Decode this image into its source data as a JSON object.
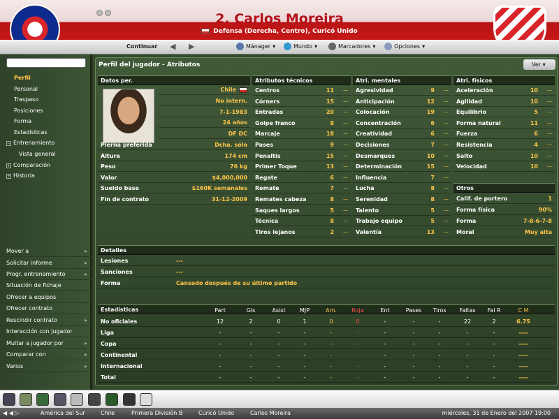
{
  "header": {
    "title": "2. Carlos Moreira",
    "subtitle": "Defensa (Derecha, Centro), Curicó Unido",
    "continuar": "Continuar",
    "menus": [
      "Mánager",
      "Mundo",
      "Marcadores",
      "Opciones"
    ]
  },
  "sidebar": {
    "items": [
      "Perfil",
      "Personal",
      "Traspaso",
      "Posiciones",
      "Forma",
      "Estadísticas",
      "Entrenamiento",
      "Vista general",
      "Comparación",
      "Historia"
    ],
    "actions": [
      "Mover a",
      "Solicitar informe",
      "Progr. entrenamiento",
      "Situación de fichaje",
      "Ofrecer a equipos",
      "Ofrecer contrato",
      "Rescindir contrato",
      "Interacción con jugador",
      "Multar a jugador por",
      "Comparar con",
      "Varios"
    ]
  },
  "panel": {
    "title": "Perfil del jugador - Atributos",
    "ver": "Ver"
  },
  "personal": {
    "heading": "Datos per.",
    "nationality": "Chile",
    "intl": "No intern.",
    "dob": "7-1-1983",
    "age": "24 años",
    "pos": "DF DC",
    "rows": [
      {
        "k": "Pierna preferida",
        "v": "Dcha. sólo"
      },
      {
        "k": "Altura",
        "v": "174 cm"
      },
      {
        "k": "Peso",
        "v": "76 kg"
      },
      {
        "k": "Valor",
        "v": "$4,000,000"
      },
      {
        "k": "Sueldo base",
        "v": "$160K semanales"
      },
      {
        "k": "Fin de contrato",
        "v": "31-12-2009"
      }
    ]
  },
  "technical": {
    "heading": "Atributos técnicos",
    "rows": [
      {
        "k": "Centros",
        "v": "11"
      },
      {
        "k": "Córners",
        "v": "15"
      },
      {
        "k": "Entradas",
        "v": "20"
      },
      {
        "k": "Golpe franco",
        "v": "8"
      },
      {
        "k": "Marcaje",
        "v": "18"
      },
      {
        "k": "Pases",
        "v": "9"
      },
      {
        "k": "Penaltis",
        "v": "15"
      },
      {
        "k": "Primer Toque",
        "v": "13"
      },
      {
        "k": "Regate",
        "v": "6"
      },
      {
        "k": "Remate",
        "v": "7"
      },
      {
        "k": "Remates cabeza",
        "v": "8"
      },
      {
        "k": "Saques largos",
        "v": "5"
      },
      {
        "k": "Técnica",
        "v": "8"
      },
      {
        "k": "Tiros lejanos",
        "v": "2"
      }
    ]
  },
  "mental": {
    "heading": "Atri. mentales",
    "rows": [
      {
        "k": "Agresividad",
        "v": "9"
      },
      {
        "k": "Anticipación",
        "v": "12"
      },
      {
        "k": "Colocación",
        "v": "19"
      },
      {
        "k": "Concentración",
        "v": "6"
      },
      {
        "k": "Creatividad",
        "v": "6"
      },
      {
        "k": "Decisiones",
        "v": "7"
      },
      {
        "k": "Desmarques",
        "v": "10"
      },
      {
        "k": "Determinación",
        "v": "15"
      },
      {
        "k": "Influencia",
        "v": "7"
      },
      {
        "k": "Lucha",
        "v": "8"
      },
      {
        "k": "Serenidad",
        "v": "8"
      },
      {
        "k": "Talento",
        "v": "5"
      },
      {
        "k": "Trabajo equipo",
        "v": "5"
      },
      {
        "k": "Valentía",
        "v": "13"
      }
    ]
  },
  "physical": {
    "heading": "Atri. físicos",
    "rows": [
      {
        "k": "Aceleración",
        "v": "10"
      },
      {
        "k": "Agilidad",
        "v": "10"
      },
      {
        "k": "Equilibrio",
        "v": "5"
      },
      {
        "k": "Forma natural",
        "v": "11"
      },
      {
        "k": "Fuerza",
        "v": "6"
      },
      {
        "k": "Resistencia",
        "v": "4"
      },
      {
        "k": "Salto",
        "v": "10"
      },
      {
        "k": "Velocidad",
        "v": "10"
      }
    ]
  },
  "otros": {
    "heading": "Otros",
    "rows": [
      {
        "k": "Calif. de portero",
        "v": "1"
      },
      {
        "k": "Forma física",
        "v": "90%"
      },
      {
        "k": "Forma",
        "v": "7-8-6-7-8"
      },
      {
        "k": "Moral",
        "v": "Muy alta"
      }
    ]
  },
  "details": {
    "heading": "Detalles",
    "rows": [
      {
        "k": "Lesiones",
        "v": "---"
      },
      {
        "k": "Sanciones",
        "v": "---"
      },
      {
        "k": "Forma",
        "v": "Cansado después de su último partido"
      }
    ]
  },
  "stats": {
    "heading": "Estadísticas",
    "cols": [
      "Part",
      "Gls",
      "Asist",
      "MJP",
      "Am.",
      "Roja",
      "Ent",
      "Pases",
      "Tiros",
      "Faltas",
      "Fal R",
      "C M"
    ],
    "rows": [
      {
        "k": "No oficiales",
        "v": [
          "12",
          "2",
          "0",
          "1",
          "0",
          "0",
          "-",
          "-",
          "-",
          "22",
          "2",
          "6.75"
        ]
      },
      {
        "k": "Liga",
        "v": [
          "-",
          "-",
          "-",
          "-",
          "-",
          "-",
          "-",
          "-",
          "-",
          "-",
          "-",
          "----"
        ]
      },
      {
        "k": "Copa",
        "v": [
          "-",
          "-",
          "-",
          "-",
          "-",
          "-",
          "-",
          "-",
          "-",
          "-",
          "-",
          "----"
        ]
      },
      {
        "k": "Continental",
        "v": [
          "-",
          "-",
          "-",
          "-",
          "-",
          "-",
          "-",
          "-",
          "-",
          "-",
          "-",
          "----"
        ]
      },
      {
        "k": "Internacional",
        "v": [
          "-",
          "-",
          "-",
          "-",
          "-",
          "-",
          "-",
          "-",
          "-",
          "-",
          "-",
          "----"
        ]
      },
      {
        "k": "Total",
        "v": [
          "-",
          "-",
          "-",
          "-",
          "-",
          "-",
          "-",
          "-",
          "-",
          "-",
          "-",
          "----"
        ]
      }
    ]
  },
  "statusbar": {
    "breadcrumb": [
      "América del Sur",
      "Chile",
      "Primera División B",
      "Curicó Unido",
      "Carlos Moreira"
    ],
    "datetime": "miércoles, 31 de Enero del 2007 19:00"
  }
}
